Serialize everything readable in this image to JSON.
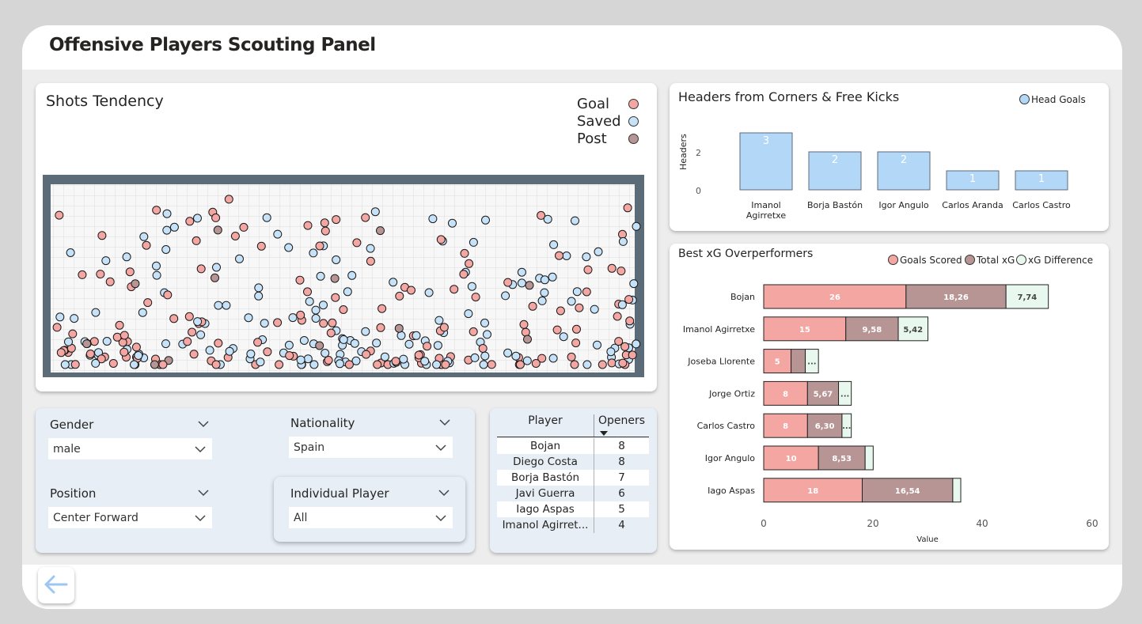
{
  "page": {
    "title": "Offensive Players Scouting Panel"
  },
  "shots": {
    "title": "Shots Tendency",
    "legend": [
      {
        "label": "Goal",
        "color": "#f4a6a3"
      },
      {
        "label": "Saved",
        "color": "#c6e2f8"
      },
      {
        "label": "Post",
        "color": "#b89595"
      }
    ]
  },
  "headers_chart": {
    "title": "Headers from Corners & Free Kicks",
    "legend_label": "Head Goals",
    "ylabel": "Headers",
    "yticks": [
      "0",
      "2"
    ]
  },
  "xg_chart": {
    "title": "Best xG Overperformers",
    "legend": [
      "Goals Scored",
      "Total xG",
      "xG Difference"
    ],
    "xlabel": "Value",
    "xticks": [
      "0",
      "20",
      "40",
      "60"
    ]
  },
  "filters": {
    "gender": {
      "label": "Gender",
      "value": "male"
    },
    "nationality": {
      "label": "Nationality",
      "value": "Spain"
    },
    "position": {
      "label": "Position",
      "value": "Center Forward"
    },
    "player": {
      "label": "Individual Player",
      "value": "All"
    }
  },
  "openers_table": {
    "headers": [
      "Player",
      "Openers"
    ],
    "rows": [
      {
        "player": "Bojan",
        "openers": "8"
      },
      {
        "player": "Diego Costa",
        "openers": "8"
      },
      {
        "player": "Borja Bastón",
        "openers": "7"
      },
      {
        "player": "Javi Guerra",
        "openers": "6"
      },
      {
        "player": "Iago Aspas",
        "openers": "5"
      },
      {
        "player": "Imanol Agirret...",
        "openers": "4"
      }
    ]
  },
  "chart_data": [
    {
      "type": "bar",
      "title": "Headers from Corners & Free Kicks",
      "categories": [
        "Imanol Agirretxe",
        "Borja Bastón",
        "Igor Angulo",
        "Carlos Aranda",
        "Carlos Castro"
      ],
      "series": [
        {
          "name": "Head Goals",
          "values": [
            3,
            2,
            2,
            1,
            1
          ]
        }
      ],
      "ylabel": "Headers",
      "ylim": [
        0,
        3
      ],
      "color": "#b3d7f7"
    },
    {
      "type": "bar",
      "orientation": "horizontal-stacked",
      "title": "Best xG Overperformers",
      "categories": [
        "Bojan",
        "Imanol Agirretxe",
        "Joseba Llorente",
        "Jorge Ortiz",
        "Carlos Castro",
        "Igor Angulo",
        "Iago Aspas"
      ],
      "series": [
        {
          "name": "Goals Scored",
          "values": [
            26,
            15,
            5,
            8,
            8,
            10,
            18
          ],
          "labels": [
            "26",
            "15",
            "5",
            "8",
            "8",
            "10",
            "18"
          ],
          "color": "#f4a6a3"
        },
        {
          "name": "Total xG",
          "values": [
            18.26,
            9.58,
            2.6,
            5.67,
            6.3,
            8.53,
            16.54
          ],
          "labels": [
            "18,26",
            "9,58",
            "",
            "5,67",
            "6,30",
            "8,53",
            "16,54"
          ],
          "color": "#b89595"
        },
        {
          "name": "xG Difference",
          "values": [
            7.74,
            5.42,
            2.4,
            2.33,
            1.7,
            1.47,
            1.46
          ],
          "labels": [
            "7,74",
            "5,42",
            "...",
            "...",
            "...",
            "",
            ""
          ],
          "color": "#e8f8ef"
        }
      ],
      "xlabel": "Value",
      "xlim": [
        0,
        60
      ]
    }
  ]
}
